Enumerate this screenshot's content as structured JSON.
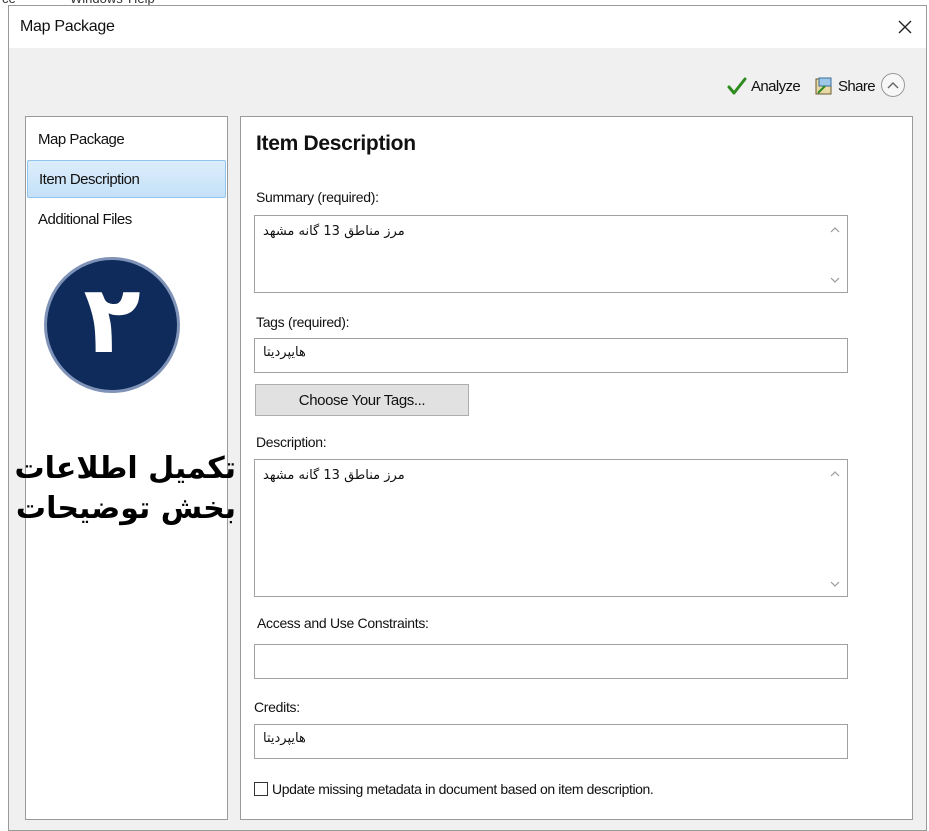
{
  "dialog": {
    "title": "Map Package"
  },
  "toolbar": {
    "analyze_label": "Analyze",
    "share_label": "Share"
  },
  "sidebar": {
    "items": [
      {
        "label": "Map Package",
        "selected": false
      },
      {
        "label": "Item Description",
        "selected": true
      },
      {
        "label": "Additional Files",
        "selected": false
      }
    ],
    "overlay": {
      "step_number": "۲",
      "line1": "تکمیل اطلاعات",
      "line2": "بخش توضیحات"
    }
  },
  "item_description": {
    "title": "Item Description",
    "summary": {
      "label": "Summary (required):",
      "value": "مرز مناطق 13 گانه مشهد"
    },
    "tags": {
      "label": "Tags (required):",
      "value": "هایپردیتا"
    },
    "choose_tags_label": "Choose Your Tags...",
    "description": {
      "label": "Description:",
      "value": "مرز مناطق 13 گانه مشهد"
    },
    "access": {
      "label": "Access and Use Constraints:",
      "value": ""
    },
    "credits": {
      "label": "Credits:",
      "value": "هایپردیتا"
    },
    "update_metadata": {
      "label": "Update missing metadata in document based on item description.",
      "checked": false
    }
  },
  "colors": {
    "dialog_bg": "#f0f0f0",
    "selection": "#c5e1f8",
    "badge_fill": "#0f2b5b",
    "analyze_check": "#2e8b1f"
  },
  "icons": {
    "close": "close-icon",
    "analyze": "checkmark-icon",
    "share": "share-package-icon",
    "collapse": "chevron-up-circle-icon"
  }
}
